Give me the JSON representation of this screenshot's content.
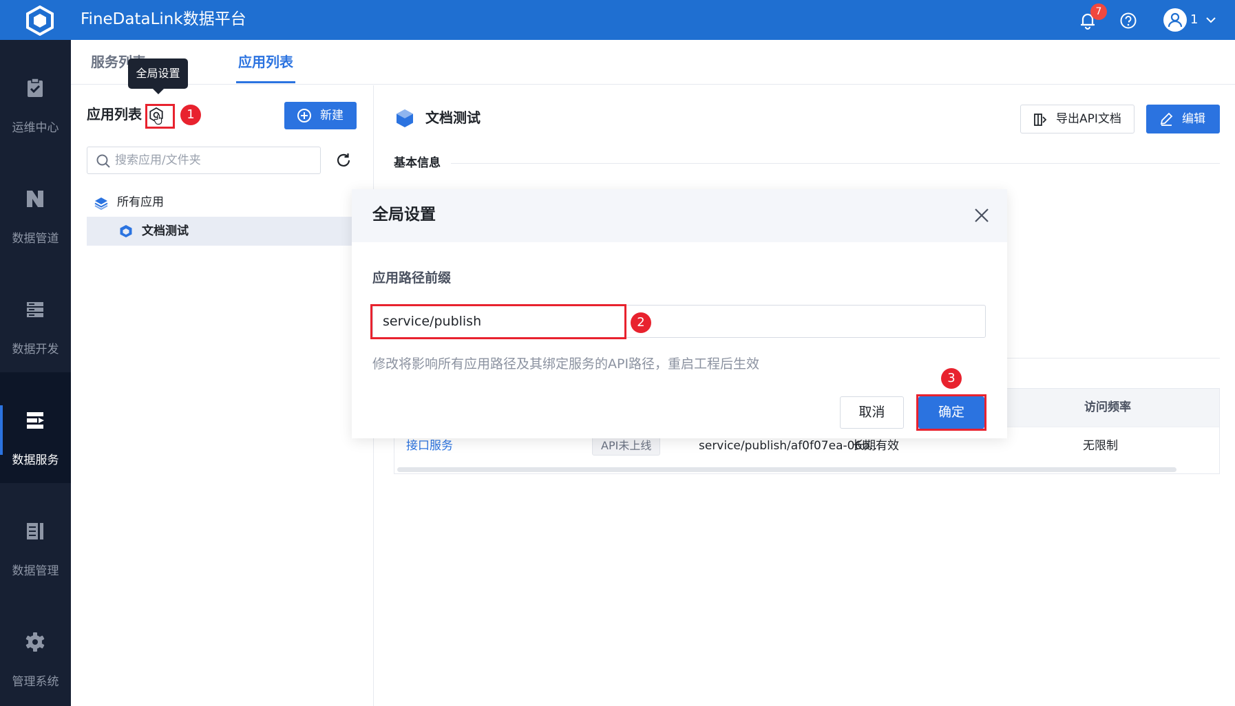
{
  "app": {
    "title": "FineDataLink数据平台"
  },
  "header": {
    "notification_count": "7",
    "user_name": "1",
    "colors": {
      "brand": "#1f6fd1",
      "badge": "#f0483e"
    }
  },
  "sidebar": {
    "items": [
      {
        "label": "运维中心",
        "icon": "clipboard-check-icon",
        "active": false
      },
      {
        "label": "数据管道",
        "icon": "pipeline-icon",
        "active": false
      },
      {
        "label": "数据开发",
        "icon": "server-stack-icon",
        "active": false
      },
      {
        "label": "数据服务",
        "icon": "api-service-icon",
        "active": true
      },
      {
        "label": "数据管理",
        "icon": "data-manage-icon",
        "active": false
      },
      {
        "label": "管理系统",
        "icon": "gear-icon",
        "active": false
      }
    ]
  },
  "tabs": {
    "service_list": "服务列表",
    "app_list": "应用列表"
  },
  "tooltip": {
    "global_settings": "全局设置"
  },
  "left_panel": {
    "title": "应用列表",
    "new_button": "新建",
    "search_placeholder": "搜索应用/文件夹",
    "tree": {
      "all_apps": "所有应用",
      "child": "文档测试"
    }
  },
  "annotations": {
    "step1": "1",
    "step2": "2",
    "step3": "3",
    "highlight_color": "#e8222e"
  },
  "content": {
    "title": "文档测试",
    "export_button": "导出API文档",
    "edit_button": "编辑",
    "section_basic_info": "基本信息",
    "table": {
      "visible_header": "访问频率",
      "row": {
        "name": "接口服务",
        "status": "API未上线",
        "path": "service/publish/af0f07ea-06b…",
        "validity": "长期有效",
        "rate": "无限制"
      }
    }
  },
  "modal": {
    "title": "全局设置",
    "field_label": "应用路径前缀",
    "field_value": "service/publish",
    "hint": "修改将影响所有应用路径及其绑定服务的API路径，重启工程后生效",
    "cancel": "取消",
    "confirm": "确定"
  }
}
